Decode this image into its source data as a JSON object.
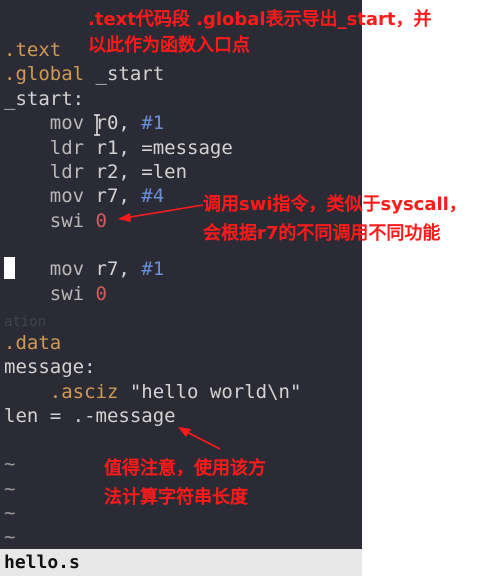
{
  "editor": {
    "lines": [
      ".text",
      ".global _start",
      "_start:",
      "    mov r0, #1",
      "    ldr r1, =message",
      "    ldr r2, =len",
      "    mov r7, #4",
      "    swi 0",
      "",
      "    mov r7, #1",
      "    swi 0",
      "",
      ".data",
      "message:",
      "    .asciz \"hello world\\n\"",
      "len = .-message",
      "",
      "~",
      "~",
      "~",
      "~"
    ],
    "tokens": {
      "text_dir": ".text",
      "global_dir": ".global",
      "start_sym": " _start",
      "start_label": "_start:",
      "mov": "mov",
      "ldr": "ldr",
      "swi": "swi",
      "r0": " r0, ",
      "r1": " r1, =message",
      "r2": " r2, =len",
      "r7": " r7, ",
      "n1": "#1",
      "n4": "#4",
      "zero": "0",
      "data_dir": ".data",
      "message_label": "message:",
      "asciz": ".asciz",
      "str": " \"hello world\\n\"",
      "len_line": "len = .-message",
      "tilde": "~",
      "faded": "ation"
    }
  },
  "statusbar": {
    "filename": "hello.s"
  },
  "annotations": {
    "top_line1": ".text代码段 .global表示导出_start，并",
    "top_line2": "以此作为函数入口点",
    "swi_line1": "调用swi指令，类似于syscall，",
    "swi_line2": "会根据r7的不同调用不同功能",
    "len_line1": "值得注意，使用该方",
    "len_line2": "法计算字符串长度"
  },
  "colors": {
    "editor_bg": "#2b2b35",
    "directive": "#d09a55",
    "number": "#6a8fd8",
    "zero": "#d65a5a",
    "annotation": "#ff1a1a",
    "statusbar_bg": "#e7e7e7"
  }
}
